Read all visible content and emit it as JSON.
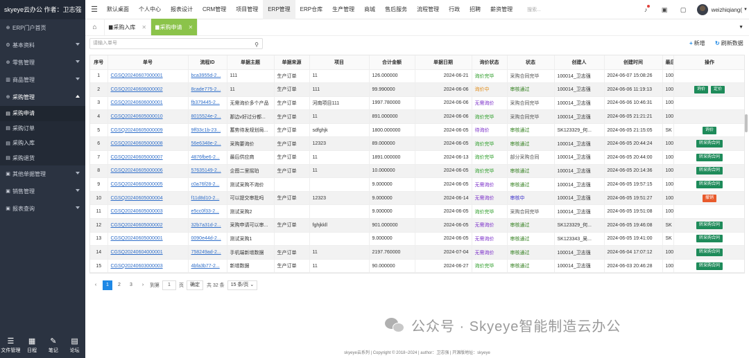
{
  "sidebar": {
    "brand": "skyeye云办公 作者：卫志强",
    "items": [
      {
        "label": "ERP门户首页",
        "icon": "cart-icon"
      },
      {
        "label": "基本资料",
        "icon": "gear-icon"
      },
      {
        "label": "零售管理",
        "icon": "cart-icon"
      },
      {
        "label": "商品管理",
        "icon": "box-icon"
      },
      {
        "label": "采购管理",
        "icon": "cart-icon"
      }
    ],
    "purchase_sub": [
      {
        "label": "采购申请"
      },
      {
        "label": "采购订单"
      },
      {
        "label": "采购入库"
      },
      {
        "label": "采购退货"
      }
    ],
    "items_after": [
      {
        "label": "其他单据管理"
      },
      {
        "label": "销售管理"
      },
      {
        "label": "报表查询"
      }
    ],
    "footer": [
      {
        "label": "文件管理",
        "icon": "list-icon"
      },
      {
        "label": "日程",
        "icon": "calendar-icon"
      },
      {
        "label": "笔记",
        "icon": "edit-icon"
      },
      {
        "label": "论坛",
        "icon": "forum-icon"
      }
    ]
  },
  "topnav": {
    "items": [
      "默认桌面",
      "个人中心",
      "报表设计",
      "CRM管理",
      "项目管理",
      "ERP管理",
      "ERP仓库",
      "生产管理",
      "商城",
      "售后服务",
      "流程管理",
      "行政",
      "招聘",
      "薪资管理"
    ],
    "active_index": 5,
    "search_placeholder": "搜索...",
    "user_name": "weizhiqiang("
  },
  "tabs": [
    {
      "label": "采购入库",
      "active": false
    },
    {
      "label": "采购申请",
      "active": true
    }
  ],
  "toolbar": {
    "search_placeholder": "请输入单号",
    "add_label": "新增",
    "refresh_label": "刷新数据"
  },
  "table": {
    "headers": [
      "序号",
      "单号",
      "流程ID",
      "单据主题",
      "单据来源",
      "项目",
      "合计金额",
      "单据日期",
      "询价状态",
      "状态",
      "创建人",
      "创建时间",
      "最后",
      "操作"
    ],
    "rows": [
      {
        "no": "1",
        "code": "CGSQ20240607000001",
        "flow": "bca3955d-2...",
        "subject": "111",
        "source": "生产订单",
        "project": "11",
        "amount": "126.000000",
        "date": "2024-06-21",
        "inquiry": "询价完毕",
        "inquiry_cls": "st-done",
        "status": "采购合同完毕",
        "status_cls": "st-part",
        "creator": "100014_卫志强",
        "created": "2024-06-07 15:08:26",
        "last": "100",
        "ops": []
      },
      {
        "no": "2",
        "code": "CGSQ20240606000002",
        "flow": "8cade775-2...",
        "subject": "11",
        "source": "生产订单",
        "project": "111",
        "amount": "99.990000",
        "date": "2024-06-06",
        "inquiry": "询价中",
        "inquiry_cls": "st-ing",
        "status": "审核通过",
        "status_cls": "st-approve",
        "creator": "100014_卫志强",
        "created": "2024-06-06 11:19:13",
        "last": "100",
        "ops": [
          {
            "label": "询价",
            "red": false
          },
          {
            "label": "定价",
            "red": false
          }
        ]
      },
      {
        "no": "3",
        "code": "CGSQ20240606000001",
        "flow": "fb379445-2...",
        "subject": "无需询价多个产品",
        "source": "生产订单",
        "project": "河南项目111",
        "amount": "1997.780000",
        "date": "2024-06-06",
        "inquiry": "无需询价",
        "inquiry_cls": "st-none",
        "status": "采购合同完毕",
        "status_cls": "st-part",
        "creator": "100014_卫志强",
        "created": "2024-06-06 10:46:31",
        "last": "100",
        "ops": []
      },
      {
        "no": "4",
        "code": "CGSQ20240605000010",
        "flow": "8015524e-2...",
        "subject": "那边v好过分都...",
        "source": "生产订单",
        "project": "11",
        "amount": "891.000000",
        "date": "2024-06-06",
        "inquiry": "询价完毕",
        "inquiry_cls": "st-done",
        "status": "采购合同完毕",
        "status_cls": "st-part",
        "creator": "100014_卫志强",
        "created": "2024-06-05 21:21:21",
        "last": "100",
        "ops": []
      },
      {
        "no": "5",
        "code": "CGSQ20240605000009",
        "flow": "9ff33c1b-23...",
        "subject": "蓄势待发规划局...",
        "source": "生产订单",
        "project": "sdfghjk",
        "amount": "1800.000000",
        "date": "2024-06-05",
        "inquiry": "待询价",
        "inquiry_cls": "st-wait",
        "status": "审核通过",
        "status_cls": "st-approve",
        "creator": "SK123329_何...",
        "created": "2024-06-05 21:15:05",
        "last": "SK",
        "ops": [
          {
            "label": "询价",
            "red": false
          }
        ]
      },
      {
        "no": "6",
        "code": "CGSQ20240605000008",
        "flow": "56e6348e-2...",
        "subject": "采购要询价",
        "source": "生产订单",
        "project": "12323",
        "amount": "89.000000",
        "date": "2024-06-05",
        "inquiry": "询价完毕",
        "inquiry_cls": "st-done",
        "status": "审核通过",
        "status_cls": "st-approve",
        "creator": "100014_卫志强",
        "created": "2024-06-05 20:44:24",
        "last": "100",
        "ops": [
          {
            "label": "转采购合同",
            "red": false
          }
        ]
      },
      {
        "no": "7",
        "code": "CGSQ20240605000007",
        "flow": "4876fbe6-2...",
        "subject": "最后供应商",
        "source": "生产订单",
        "project": "11",
        "amount": "1891.000000",
        "date": "2024-06-13",
        "inquiry": "询价完毕",
        "inquiry_cls": "st-done",
        "status": "部分采购合同",
        "status_cls": "st-part",
        "creator": "100014_卫志强",
        "created": "2024-06-05 20:44:00",
        "last": "100",
        "ops": [
          {
            "label": "转采购合同",
            "red": false
          }
        ]
      },
      {
        "no": "8",
        "code": "CGSQ20240605000006",
        "flow": "57635149-2...",
        "subject": "企图二里摇珀",
        "source": "生产订单",
        "project": "11",
        "amount": "10.000000",
        "date": "2024-06-05",
        "inquiry": "询价完毕",
        "inquiry_cls": "st-done",
        "status": "审核通过",
        "status_cls": "st-approve",
        "creator": "100014_卫志强",
        "created": "2024-06-05 20:14:36",
        "last": "100",
        "ops": [
          {
            "label": "转采购合同",
            "red": false
          }
        ]
      },
      {
        "no": "9",
        "code": "CGSQ20240605000005",
        "flow": "c0a76f28-2...",
        "subject": "测试采购不询价",
        "source": "",
        "project": "",
        "amount": "9.000000",
        "date": "2024-06-05",
        "inquiry": "无需询价",
        "inquiry_cls": "st-none",
        "status": "审核通过",
        "status_cls": "st-approve",
        "creator": "100014_卫志强",
        "created": "2024-06-05 19:57:15",
        "last": "100",
        "ops": [
          {
            "label": "转采购合同",
            "red": false
          }
        ]
      },
      {
        "no": "10",
        "code": "CGSQ20240605000004",
        "flow": "f11d8d10-2...",
        "subject": "可以提交审批吗",
        "source": "生产订单",
        "project": "12323",
        "amount": "9.000000",
        "date": "2024-06-14",
        "inquiry": "无需询价",
        "inquiry_cls": "st-none",
        "status": "审核中",
        "status_cls": "st-review",
        "creator": "100014_卫志强",
        "created": "2024-06-05 19:51:27",
        "last": "100",
        "ops": [
          {
            "label": "撤销",
            "red": true
          }
        ]
      },
      {
        "no": "11",
        "code": "CGSQ20240605000003",
        "flow": "e5cc0f33-2...",
        "subject": "测试采购2",
        "source": "",
        "project": "",
        "amount": "9.000000",
        "date": "2024-06-05",
        "inquiry": "询价完毕",
        "inquiry_cls": "st-done",
        "status": "采购合同完毕",
        "status_cls": "st-part",
        "creator": "100014_卫志强",
        "created": "2024-06-05 19:51:08",
        "last": "100",
        "ops": []
      },
      {
        "no": "12",
        "code": "CGSQ20240605000002",
        "flow": "32b7a31d-2...",
        "subject": "采购申请可以审...",
        "source": "生产订单",
        "project": "fghjkkll",
        "amount": "901.000000",
        "date": "2024-06-05",
        "inquiry": "无需询价",
        "inquiry_cls": "st-none",
        "status": "审核通过",
        "status_cls": "st-approve",
        "creator": "SK123329_何...",
        "created": "2024-06-05 19:46:08",
        "last": "SK",
        "ops": [
          {
            "label": "转采购合同",
            "red": false
          }
        ]
      },
      {
        "no": "13",
        "code": "CGSQ20240605000001",
        "flow": "0090e44d-2...",
        "subject": "测试采购1",
        "source": "",
        "project": "",
        "amount": "9.000000",
        "date": "2024-06-05",
        "inquiry": "无需询价",
        "inquiry_cls": "st-none",
        "status": "审核通过",
        "status_cls": "st-approve",
        "creator": "SK123343_吴...",
        "created": "2024-06-05 19:41:00",
        "last": "SK",
        "ops": [
          {
            "label": "转采购合同",
            "red": false
          }
        ]
      },
      {
        "no": "14",
        "code": "CGSQ20240604000001",
        "flow": "758249ad-2...",
        "subject": "手机端新增数据",
        "source": "生产订单",
        "project": "11",
        "amount": "2197.760000",
        "date": "2024-07-04",
        "inquiry": "无需询价",
        "inquiry_cls": "st-none",
        "status": "审核通过",
        "status_cls": "st-approve",
        "creator": "100014_卫志强",
        "created": "2024-06-04 17:07:12",
        "last": "100",
        "ops": [
          {
            "label": "转采购合同",
            "red": false
          }
        ]
      },
      {
        "no": "15",
        "code": "CGSQ20240603000003",
        "flow": "4bfa3b77-2...",
        "subject": "新增数据",
        "source": "生产订单",
        "project": "11",
        "amount": "90.000000",
        "date": "2024-06-27",
        "inquiry": "询价完毕",
        "inquiry_cls": "st-done",
        "status": "审核通过",
        "status_cls": "st-approve",
        "creator": "100014_卫志强",
        "created": "2024-06-03 20:46:28",
        "last": "100",
        "ops": [
          {
            "label": "转采购合同",
            "red": false
          }
        ]
      }
    ]
  },
  "pager": {
    "pages": [
      "1",
      "2",
      "3"
    ],
    "active": "1",
    "goto_label": "到第",
    "goto_value": "1",
    "page_unit": "页",
    "confirm": "确定",
    "total": "共 32 条",
    "per_page": "15 条/页"
  },
  "watermark": "公众号 · Skyeye智能制造云办公",
  "footer": "skyeye云系列 | Copyright © 2018~2024 | author：卫志强 | 开源版地址：skyeye"
}
